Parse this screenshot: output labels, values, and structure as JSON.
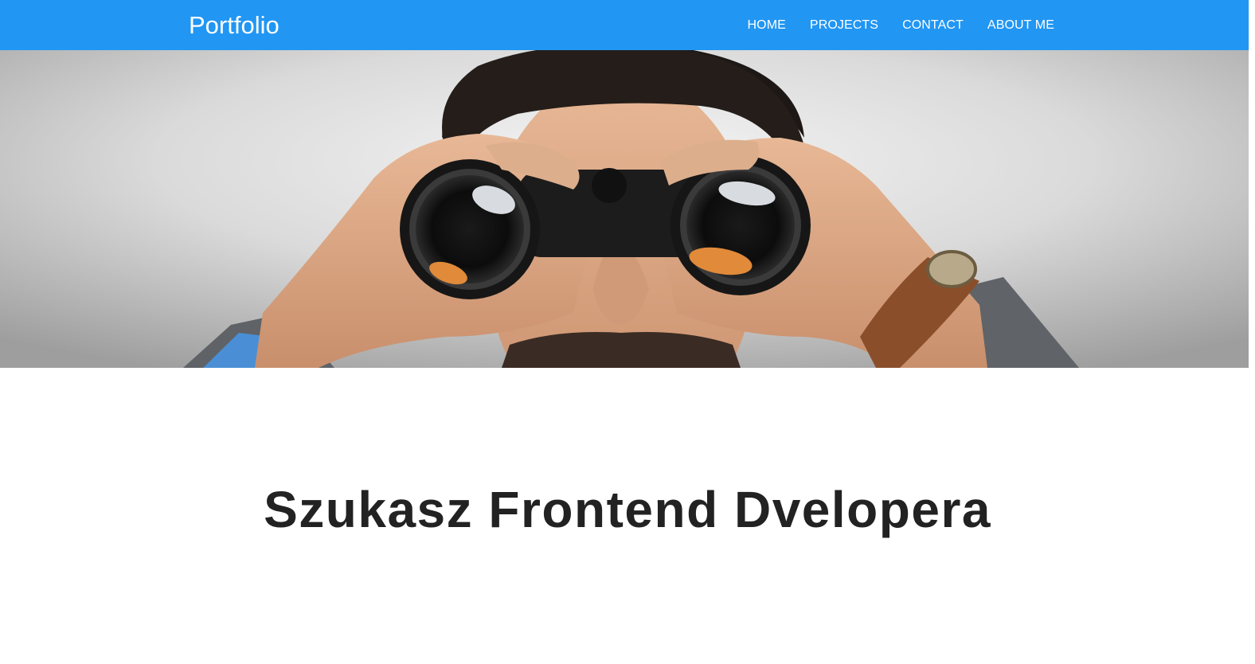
{
  "navbar": {
    "brand": "Portfolio",
    "links": [
      "HOME",
      "PROJECTS",
      "CONTACT",
      "ABOUT ME"
    ],
    "background_color": "#2196f3"
  },
  "hero": {
    "image": "man-looking-through-binoculars-photo"
  },
  "main": {
    "headline": "Szukasz Frontend Dvelopera"
  }
}
